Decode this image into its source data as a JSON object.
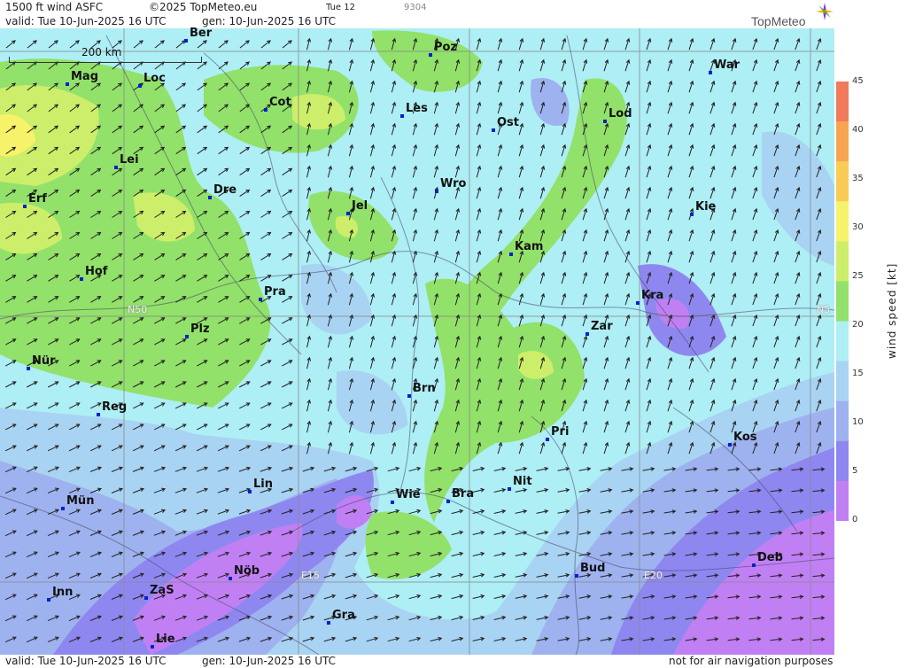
{
  "header": {
    "title": "1500 ft wind ASFC",
    "copyright": "©2025 TopMeteo.eu",
    "tab": "Tue 12",
    "code": "9304",
    "valid": "valid:  Tue  10-Jun-2025  16 UTC",
    "gen": "gen: 10-Jun-2025 16 UTC"
  },
  "footer": {
    "valid": "valid:  Tue  10-Jun-2025  16 UTC",
    "gen": "gen: 10-Jun-2025 16 UTC",
    "note": "not for air navigation purposes"
  },
  "brand": "TopMeteo",
  "scale_label": "200 km",
  "legend": {
    "unit": "wind speed [kt]",
    "ticks": [
      "45",
      "40",
      "35",
      "30",
      "25",
      "20",
      "15",
      "10",
      "5",
      "0"
    ],
    "colors": [
      "#f07a5a",
      "#f7a552",
      "#f9cd55",
      "#f6f26a",
      "#cdee6a",
      "#92e16a",
      "#aeeef5",
      "#a9d3f2",
      "#9eb2ef",
      "#8f87f0",
      "#c080f4"
    ]
  },
  "coords": {
    "n50": "N50",
    "n5": "N5",
    "e15": "E15",
    "e20": "E20"
  },
  "cities": {
    "ber": "Ber",
    "poz": "Poz",
    "war": "War",
    "mag": "Mag",
    "loc": "Loc",
    "cot": "Cot",
    "les": "Les",
    "ost": "Ost",
    "lod": "Lod",
    "lei": "Lei",
    "erf": "Erf",
    "dre": "Dre",
    "wro": "Wro",
    "jel": "Jel",
    "kie": "Kie",
    "kam": "Kam",
    "hof": "Hof",
    "pra": "Pra",
    "kra": "Kra",
    "zar": "Zar",
    "plz": "Plz",
    "nur": "Nür",
    "brn": "Brn",
    "reg": "Reg",
    "pri": "Pri",
    "kos": "Kos",
    "lin": "Lin",
    "wie": "Wie",
    "bra": "Bra",
    "nit": "Nit",
    "mun": "Mün",
    "nob": "Nöb",
    "bud": "Bud",
    "deb": "Deb",
    "inn": "Inn",
    "zas": "ZaS",
    "gra": "Gra",
    "lie": "Lie"
  }
}
